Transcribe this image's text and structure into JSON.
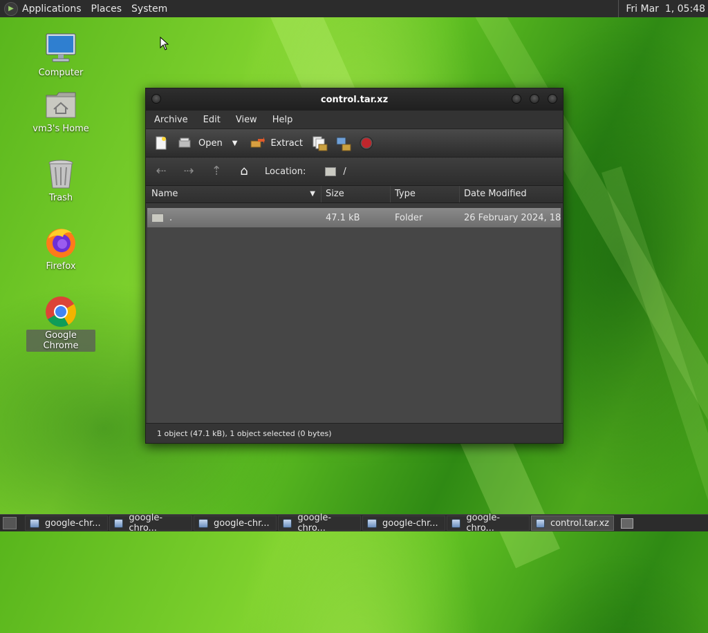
{
  "top_panel": {
    "menus": [
      "Applications",
      "Places",
      "System"
    ],
    "clock": "Fri Mar  1, 05:48"
  },
  "desktop": {
    "icons": [
      {
        "label": "Computer",
        "icon": "computer-icon"
      },
      {
        "label": "vm3's Home",
        "icon": "home-folder-icon"
      },
      {
        "label": "Trash",
        "icon": "trash-icon"
      },
      {
        "label": "Firefox",
        "icon": "firefox-icon"
      },
      {
        "label": "Google Chrome",
        "icon": "chrome-icon",
        "selected": true
      }
    ]
  },
  "window": {
    "title": "control.tar.xz",
    "menu": [
      "Archive",
      "Edit",
      "View",
      "Help"
    ],
    "toolbar": {
      "open_label": "Open",
      "extract_label": "Extract"
    },
    "location": {
      "label": "Location:",
      "path": "/"
    },
    "columns": [
      "Name",
      "Size",
      "Type",
      "Date Modified"
    ],
    "rows": [
      {
        "name": ".",
        "size": "47.1 kB",
        "type": "Folder",
        "date": "26 February 2024, 18..."
      }
    ],
    "status": "1 object (47.1 kB), 1 object selected (0 bytes)"
  },
  "taskbar": {
    "tasks": [
      {
        "label": "google-chr..."
      },
      {
        "label": "google-chro..."
      },
      {
        "label": "google-chr..."
      },
      {
        "label": "google-chro..."
      },
      {
        "label": "google-chr..."
      },
      {
        "label": "google-chro..."
      },
      {
        "label": "control.tar.xz",
        "active": true
      }
    ]
  },
  "colors": {
    "panel_bg": "#2c2c2c",
    "window_bg": "#3a3a3a",
    "selected_row": "#7a7a7a",
    "stop_button": "#c0262c"
  }
}
